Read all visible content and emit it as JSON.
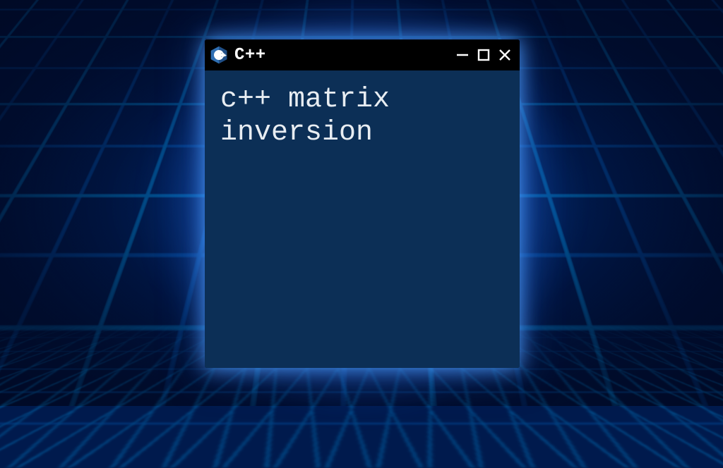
{
  "window": {
    "title": "C++",
    "icon": "cpp-logo-icon",
    "content": "c++ matrix\ninversion"
  },
  "colors": {
    "titlebar_bg": "#000000",
    "client_bg": "#0c2f56",
    "text": "#e8edf2",
    "accent_glow": "#0a8cff"
  }
}
